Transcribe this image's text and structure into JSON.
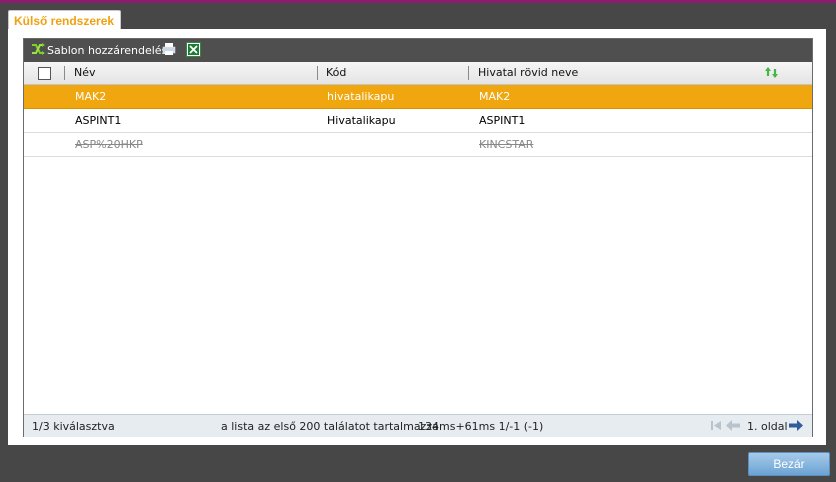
{
  "tab": {
    "title": "Külső rendszerek"
  },
  "toolbar": {
    "assign_label": "Sablon hozzárendelés",
    "icons": [
      "shuffle-icon",
      "print-icon",
      "excel-icon"
    ]
  },
  "table": {
    "columns": [
      "Név",
      "Kód",
      "Hivatal rövid neve"
    ],
    "rows": [
      {
        "nev": "MAK2",
        "kod": "hivatalikapu",
        "rovid": "MAK2",
        "state": "selected"
      },
      {
        "nev": "ASPINT1",
        "kod": "Hivatalikapu",
        "rovid": "ASPINT1",
        "state": "normal"
      },
      {
        "nev": "ASP%20HKP",
        "kod": "",
        "rovid": "KINCSTAR",
        "state": "disabled"
      }
    ]
  },
  "footer": {
    "selected": "1/3 kiválasztva",
    "info": "a lista az első 200 találatot tartalmazza",
    "timing": "134ms+61ms 1/-1 (-1)",
    "page": "1. oldal"
  },
  "close_label": "Bezár",
  "colors": {
    "accent": "#f0a60f",
    "toolbar": "#4f4f4f",
    "background": "#474747"
  }
}
